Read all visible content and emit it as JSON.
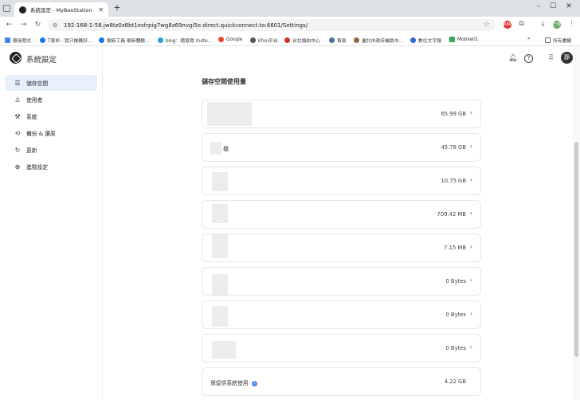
{
  "browser": {
    "tab_title": "系統設定 - MyBeeStation",
    "url": "192-168-1-58.jw8tz0z8bt1esfrpig7wg8z69nvgi5e.direct.quickconnect.to:6601/Settings/",
    "bookmarks": [
      "應用程式",
      "T客邦 - 我只推薦好...",
      "樹新工廠 樹新體驗...",
      "blog：隨意窩 Xuite...",
      "Google",
      "Efun平台",
      "台北捐血中心",
      "首頁",
      "臺北市政府補助市...",
      "數位文字報",
      "Mobile01"
    ],
    "all_bookmarks": "所有書籤",
    "avatar_label": "已暫停",
    "ext_label": "ABP"
  },
  "app": {
    "title": "系統設定",
    "user_initial": "靜",
    "nav": [
      {
        "label": "儲存空間",
        "icon": "storage-icon"
      },
      {
        "label": "使用者",
        "icon": "user-icon"
      },
      {
        "label": "系統",
        "icon": "wrench-icon"
      },
      {
        "label": "備份 & 還原",
        "icon": "history-icon"
      },
      {
        "label": "更新",
        "icon": "refresh-icon"
      },
      {
        "label": "進階設定",
        "icon": "advanced-icon"
      }
    ]
  },
  "storage": {
    "title": "儲存空間使用量",
    "items": [
      {
        "name": "",
        "size": "65.99 GB"
      },
      {
        "name": "檔",
        "size": "45.78 GB"
      },
      {
        "name": "",
        "size": "10.75 GB"
      },
      {
        "name": "",
        "size": "709.42 MB"
      },
      {
        "name": "",
        "size": "7.15 MB"
      },
      {
        "name": "",
        "size": "0 Bytes"
      },
      {
        "name": "",
        "size": "0 Bytes"
      },
      {
        "name": "",
        "size": "0 Bytes"
      },
      {
        "name": "保留供系統使用",
        "size": "4.22 GB"
      }
    ]
  }
}
